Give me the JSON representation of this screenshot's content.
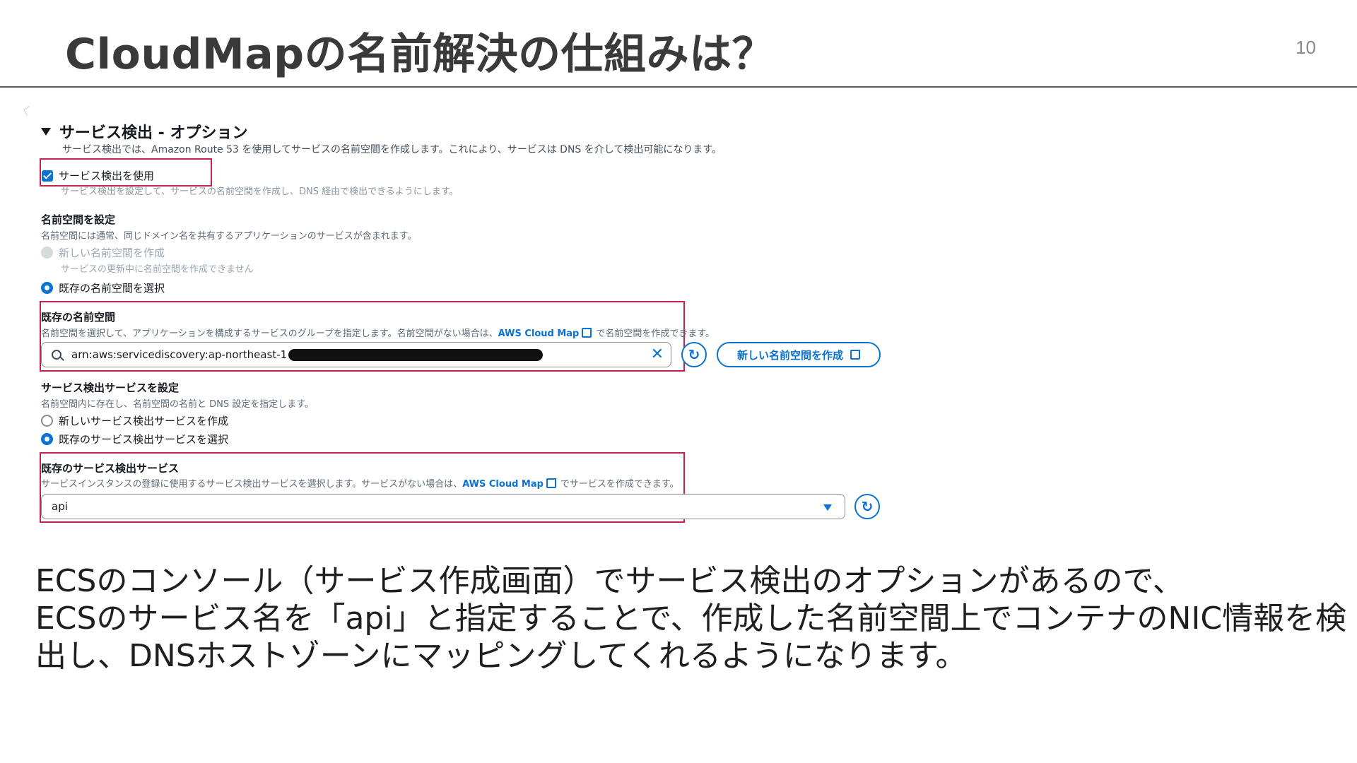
{
  "slide": {
    "title": "CloudMapの名前解決の仕組みは？",
    "page_number": "10"
  },
  "panel": {
    "section_title": "サービス検出 - オプション",
    "section_desc": "サービス検出では、Amazon Route 53 を使用してサービスの名前空間を作成します。これにより、サービスは DNS を介して検出可能になります。",
    "use_discovery": {
      "label": "サービス検出を使用",
      "help": "サービス検出を設定して、サービスの名前空間を作成し、DNS 経由で検出できるようにします。",
      "checked": true
    },
    "namespace_config": {
      "label": "名前空間を設定",
      "help": "名前空間には通常、同じドメイン名を共有するアプリケーションのサービスが含まれます。",
      "option_new": "新しい名前空間を作成",
      "option_new_help": "サービスの更新中に名前空間を作成できません",
      "option_existing": "既存の名前空間を選択"
    },
    "existing_namespace": {
      "label": "既存の名前空間",
      "help_before": "名前空間を選択して、アプリケーションを構成するサービスのグループを指定します。名前空間がない場合は、",
      "link": "AWS Cloud Map",
      "help_after": "で名前空間を作成できます。",
      "value": "arn:aws:servicediscovery:ap-northeast-1",
      "create_button": "新しい名前空間を作成"
    },
    "discovery_service_config": {
      "label": "サービス検出サービスを設定",
      "help": "名前空間内に存在し、名前空間の名前と DNS 設定を指定します。",
      "option_new": "新しいサービス検出サービスを作成",
      "option_existing": "既存のサービス検出サービスを選択"
    },
    "existing_service": {
      "label": "既存のサービス検出サービス",
      "help_before": "サービスインスタンスの登録に使用するサービス検出サービスを選択します。サービスがない場合は、",
      "link": "AWS Cloud Map",
      "help_after": "でサービスを作成できます。",
      "value": "api"
    }
  },
  "body_text": [
    "ECSのコンソール（サービス作成画面）でサービス検出のオプションがあるので、",
    "ECSのサービス名を「api」と指定することで、作成した名前空間上でコンテナのNIC情報を検出し、DNSホストゾーンにマッピングしてくれるようになります。"
  ],
  "colors": {
    "accent": "#0972d3",
    "highlight": "#c6224e",
    "rule": "#5a5a5a"
  }
}
